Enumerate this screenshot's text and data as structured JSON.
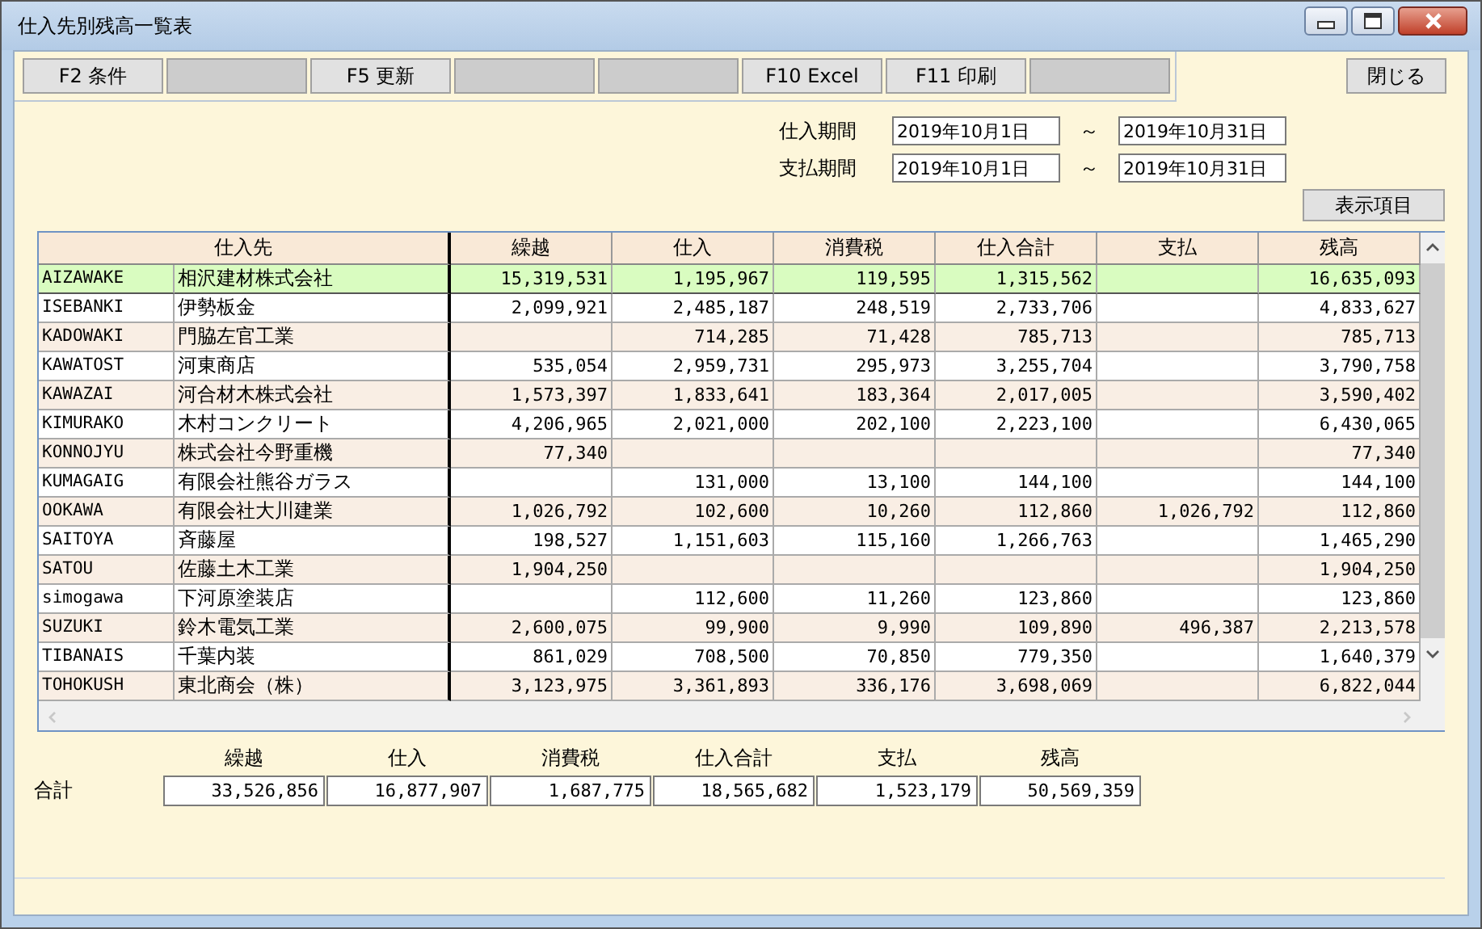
{
  "window": {
    "title": "仕入先別残高一覧表"
  },
  "toolbar": [
    {
      "kind": "key",
      "label": "F2 条件"
    },
    {
      "kind": "blank"
    },
    {
      "kind": "key",
      "label": "F5 更新"
    },
    {
      "kind": "blank"
    },
    {
      "kind": "blank"
    },
    {
      "kind": "key",
      "label": "F10 Excel"
    },
    {
      "kind": "key",
      "label": "F11 印刷"
    },
    {
      "kind": "blank"
    }
  ],
  "close_button": "閉じる",
  "periods": [
    {
      "label": "仕入期間",
      "from": "2019年10月1日",
      "separator": "～",
      "to": "2019年10月31日"
    },
    {
      "label": "支払期間",
      "from": "2019年10月1日",
      "separator": "～",
      "to": "2019年10月31日"
    }
  ],
  "display_items_button": "表示項目",
  "table": {
    "supplier_header": "仕入先",
    "amount_columns": {
      "carry_over": "繰越",
      "purchase": "仕入",
      "tax": "消費税",
      "purchase_total": "仕入合計",
      "payment": "支払",
      "balance": "残高"
    },
    "rows": [
      {
        "selected": true,
        "code": "AIZAWAKE",
        "name": "相沢建材株式会社",
        "carry_over": "15,319,531",
        "purchase": "1,195,967",
        "tax": "119,595",
        "purchase_total": "1,315,562",
        "balance": "16,635,093"
      },
      {
        "selected": false,
        "code": "ISEBANKI",
        "name": "伊勢板金",
        "carry_over": "2,099,921",
        "purchase": "2,485,187",
        "tax": "248,519",
        "purchase_total": "2,733,706",
        "balance": "4,833,627"
      },
      {
        "selected": false,
        "code": "KADOWAKI",
        "name": "門脇左官工業",
        "purchase": "714,285",
        "tax": "71,428",
        "purchase_total": "785,713",
        "balance": "785,713"
      },
      {
        "selected": false,
        "code": "KAWATOST",
        "name": "河東商店",
        "carry_over": "535,054",
        "purchase": "2,959,731",
        "tax": "295,973",
        "purchase_total": "3,255,704",
        "balance": "3,790,758"
      },
      {
        "selected": false,
        "code": "KAWAZAI",
        "name": "河合材木株式会社",
        "carry_over": "1,573,397",
        "purchase": "1,833,641",
        "tax": "183,364",
        "purchase_total": "2,017,005",
        "balance": "3,590,402"
      },
      {
        "selected": false,
        "code": "KIMURAKO",
        "name": "木村コンクリート",
        "carry_over": "4,206,965",
        "purchase": "2,021,000",
        "tax": "202,100",
        "purchase_total": "2,223,100",
        "balance": "6,430,065"
      },
      {
        "selected": false,
        "code": "KONNOJYU",
        "name": "株式会社今野重機",
        "carry_over": "77,340",
        "balance": "77,340"
      },
      {
        "selected": false,
        "code": "KUMAGAIG",
        "name": "有限会社熊谷ガラス",
        "purchase": "131,000",
        "tax": "13,100",
        "purchase_total": "144,100",
        "balance": "144,100"
      },
      {
        "selected": false,
        "code": "OOKAWA",
        "name": "有限会社大川建業",
        "carry_over": "1,026,792",
        "purchase": "102,600",
        "tax": "10,260",
        "purchase_total": "112,860",
        "payment": "1,026,792",
        "balance": "112,860"
      },
      {
        "selected": false,
        "code": "SAITOYA",
        "name": "斉藤屋",
        "carry_over": "198,527",
        "purchase": "1,151,603",
        "tax": "115,160",
        "purchase_total": "1,266,763",
        "balance": "1,465,290"
      },
      {
        "selected": false,
        "code": "SATOU",
        "name": "佐藤土木工業",
        "carry_over": "1,904,250",
        "balance": "1,904,250"
      },
      {
        "selected": false,
        "code": "simogawa",
        "name": "下河原塗装店",
        "purchase": "112,600",
        "tax": "11,260",
        "purchase_total": "123,860",
        "balance": "123,860"
      },
      {
        "selected": false,
        "code": "SUZUKI",
        "name": "鈴木電気工業",
        "carry_over": "2,600,075",
        "purchase": "99,900",
        "tax": "9,990",
        "purchase_total": "109,890",
        "payment": "496,387",
        "balance": "2,213,578"
      },
      {
        "selected": false,
        "code": "TIBANAIS",
        "name": "千葉内装",
        "carry_over": "861,029",
        "purchase": "708,500",
        "tax": "70,850",
        "purchase_total": "779,350",
        "balance": "1,640,379"
      },
      {
        "selected": false,
        "code": "TOHOKUSH",
        "name": "東北商会（株）",
        "carry_over": "3,123,975",
        "purchase": "3,361,893",
        "tax": "336,176",
        "purchase_total": "3,698,069",
        "balance": "6,822,044"
      }
    ]
  },
  "totals": {
    "label": "合計",
    "columns": [
      "繰越",
      "仕入",
      "消費税",
      "仕入合計",
      "支払",
      "残高"
    ],
    "values": [
      "33,526,856",
      "16,877,907",
      "1,687,775",
      "18,565,682",
      "1,523,179",
      "50,569,359"
    ]
  }
}
